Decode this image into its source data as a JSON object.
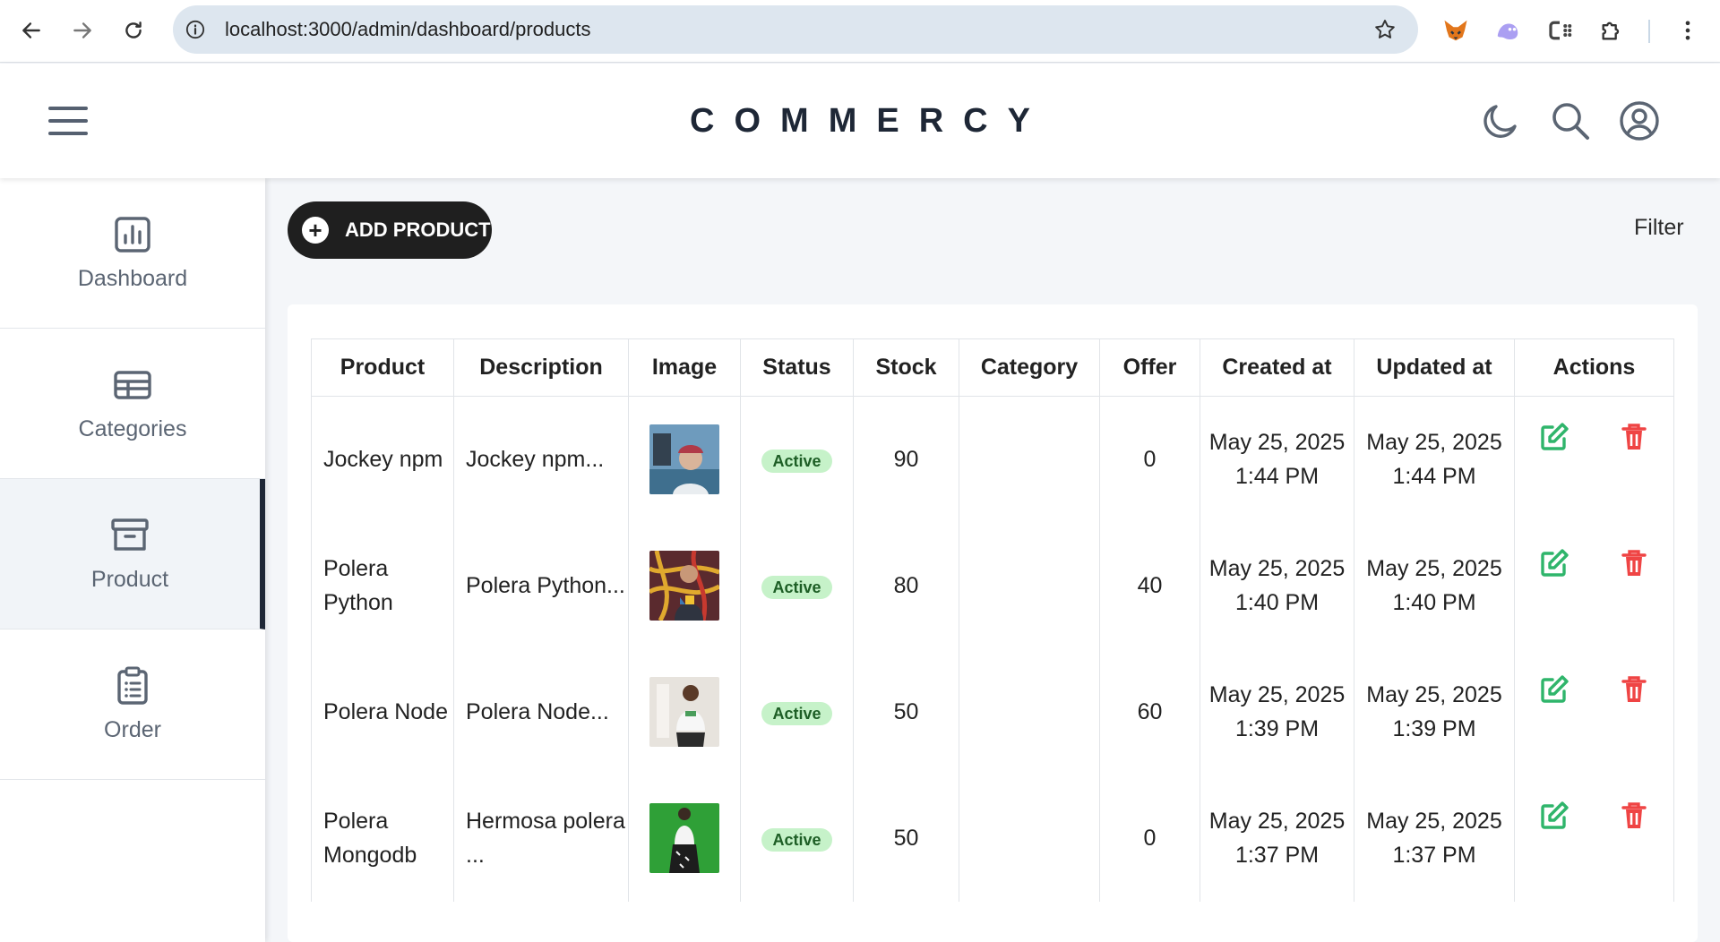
{
  "browser": {
    "url": "localhost:3000/admin/dashboard/products",
    "icons": [
      "back-arrow-icon",
      "forward-arrow-icon",
      "reload-icon",
      "info-icon",
      "bookmark-star-icon",
      "fox-extension-icon",
      "ghost-extension-icon",
      "cs-extension-icon",
      "puzzle-extension-icon",
      "kebab-menu-icon"
    ]
  },
  "header": {
    "brand": "COMMERCY",
    "icons": [
      "hamburger-menu-icon",
      "moon-icon",
      "search-icon",
      "user-circle-icon"
    ]
  },
  "sidebar": {
    "items": [
      {
        "label": "Dashboard",
        "icon": "chart-icon"
      },
      {
        "label": "Categories",
        "icon": "table-icon"
      },
      {
        "label": "Product",
        "icon": "archive-box-icon",
        "active": true
      },
      {
        "label": "Order",
        "icon": "clipboard-list-icon"
      }
    ]
  },
  "toolbar": {
    "add_label": "ADD PRODUCT",
    "filter_label": "Filter"
  },
  "table": {
    "headers": [
      "Product",
      "Description",
      "Image",
      "Status",
      "Stock",
      "Category",
      "Offer",
      "Created at",
      "Updated at",
      "Actions"
    ],
    "rows": [
      {
        "product": "Jockey npm",
        "description": "Jockey npm...",
        "status": "Active",
        "stock": "90",
        "category": "",
        "offer": "0",
        "created": "May 25, 2025 1:44 PM",
        "updated": "May 25, 2025 1:44 PM"
      },
      {
        "product": "Polera Python",
        "description": "Polera Python...",
        "status": "Active",
        "stock": "80",
        "category": "",
        "offer": "40",
        "created": "May 25, 2025 1:40 PM",
        "updated": "May 25, 2025 1:40 PM"
      },
      {
        "product": "Polera Node",
        "description": "Polera Node...",
        "status": "Active",
        "stock": "50",
        "category": "",
        "offer": "60",
        "created": "May 25, 2025 1:39 PM",
        "updated": "May 25, 2025 1:39 PM"
      },
      {
        "product": "Polera Mongodb",
        "description": "Hermosa polera ...",
        "status": "Active",
        "stock": "50",
        "category": "",
        "offer": "0",
        "created": "May 25, 2025 1:37 PM",
        "updated": "May 25, 2025 1:37 PM"
      }
    ]
  },
  "colors": {
    "brand_dark": "#1e2736",
    "edit_green": "#2fb56b",
    "delete_red": "#ef4444",
    "badge_bg": "#c6f2c9"
  }
}
